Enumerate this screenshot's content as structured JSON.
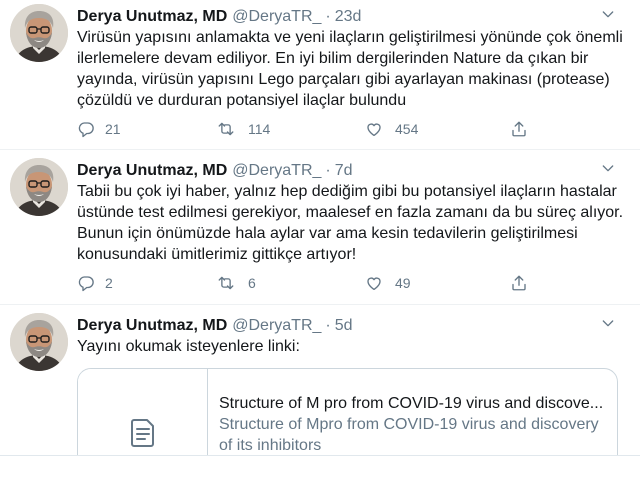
{
  "tweets": [
    {
      "author_name": "Derya Unutmaz, MD",
      "handle": "@DeryaTR_",
      "separator": "·",
      "time": "23d",
      "text": "Virüsün yapısını anlamakta ve yeni ilaçların geliştirilmesi yönünde çok önemli ilerlemelere devam ediliyor. En iyi bilim dergilerinden Nature da çıkan bir yayında, virüsün yapısını Lego parçaları gibi ayarlayan makinası (protease) çözüldü ve durduran potansiyel ilaçlar bulundu",
      "actions": {
        "reply": {
          "icon": "reply-icon",
          "count": "21"
        },
        "retweet": {
          "icon": "retweet-icon",
          "count": "114"
        },
        "like": {
          "icon": "heart-icon",
          "count": "454"
        },
        "share": {
          "icon": "share-icon"
        }
      },
      "menu_icon": "chevron-down-icon"
    },
    {
      "author_name": "Derya Unutmaz, MD",
      "handle": "@DeryaTR_",
      "separator": "·",
      "time": "7d",
      "text": "Tabii bu çok iyi haber, yalnız hep dediğim gibi bu potansiyel ilaçların hastalar üstünde test edilmesi gerekiyor, maalesef en fazla zamanı da bu süreç alıyor. Bunun için önümüzde hala aylar var ama kesin tedavilerin geliştirilmesi konusundaki ümitlerimiz gittikçe artıyor!",
      "actions": {
        "reply": {
          "icon": "reply-icon",
          "count": "2"
        },
        "retweet": {
          "icon": "retweet-icon",
          "count": "6"
        },
        "like": {
          "icon": "heart-icon",
          "count": "49"
        },
        "share": {
          "icon": "share-icon"
        }
      },
      "menu_icon": "chevron-down-icon"
    },
    {
      "author_name": "Derya Unutmaz, MD",
      "handle": "@DeryaTR_",
      "separator": "·",
      "time": "5d",
      "text": "Yayını okumak isteyenlere linki:",
      "card": {
        "icon": "document-icon",
        "title": "Structure of M pro from COVID-19 virus and discove...",
        "description": "Structure of Mpro from COVID-19 virus and discovery of its inhibitors"
      },
      "menu_icon": "chevron-down-icon"
    }
  ],
  "colors": {
    "text": "#14171a",
    "muted": "#657786",
    "card_border": "#ccd6dd",
    "divider": "#eef1f3"
  }
}
